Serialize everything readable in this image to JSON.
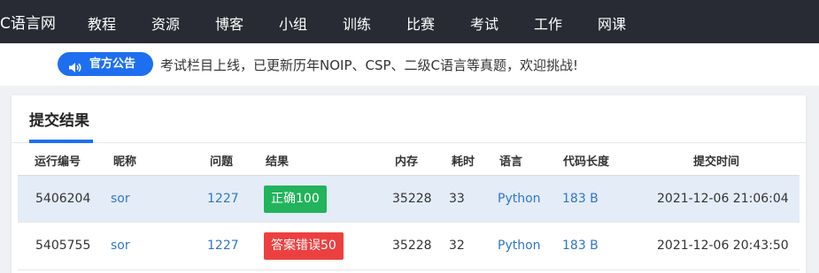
{
  "navbar": {
    "brand": "C语言网",
    "items": [
      "教程",
      "资源",
      "博客",
      "小组",
      "训练",
      "比赛",
      "考试",
      "工作",
      "网课"
    ]
  },
  "notice": {
    "badge_icon": "speaker-icon",
    "badge_label": "官方公告",
    "text": "考试栏目上线，已更新历年NOIP、CSP、二级C语言等真题，欢迎挑战!"
  },
  "card": {
    "title": "提交结果"
  },
  "table": {
    "headers": [
      "运行编号",
      "昵称",
      "问题",
      "结果",
      "内存",
      "耗时",
      "语言",
      "代码长度",
      "提交时间"
    ],
    "rows": [
      {
        "id": "5406204",
        "nickname": "sor",
        "problem": "1227",
        "result": "正确100",
        "result_status": "accepted",
        "memory": "35228",
        "time": "33",
        "language": "Python",
        "code_length": "183 B",
        "submit_time": "2021-12-06 21:06:04"
      },
      {
        "id": "5405755",
        "nickname": "sor",
        "problem": "1227",
        "result": "答案错误50",
        "result_status": "wrong-answer",
        "memory": "35228",
        "time": "32",
        "language": "Python",
        "code_length": "183 B",
        "submit_time": "2021-12-06 20:43:50"
      }
    ]
  },
  "colors": {
    "navbar_bg": "#282b33",
    "accent": "#1e6ff0",
    "link": "#2f76c7",
    "accepted": "#22b35c",
    "wrong_answer": "#ec4040",
    "highlight_row": "#e4ecf7"
  }
}
